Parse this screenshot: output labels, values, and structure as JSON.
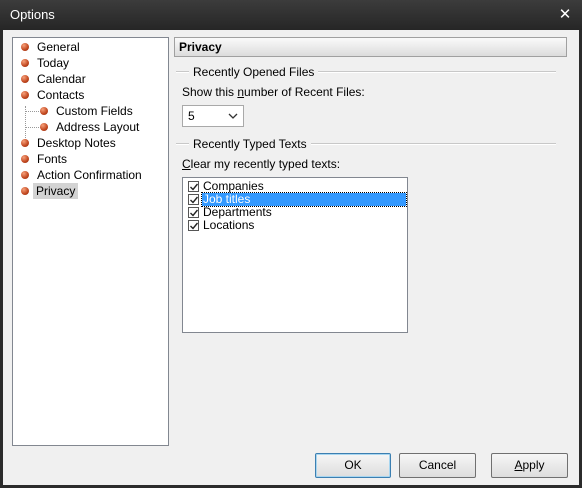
{
  "window": {
    "title": "Options",
    "close_glyph": "✕"
  },
  "tree": {
    "items": [
      {
        "label": "General"
      },
      {
        "label": "Today"
      },
      {
        "label": "Calendar"
      },
      {
        "label": "Contacts"
      },
      {
        "label": "Custom Fields"
      },
      {
        "label": "Address Layout"
      },
      {
        "label": "Desktop Notes"
      },
      {
        "label": "Fonts"
      },
      {
        "label": "Action Confirmation"
      },
      {
        "label": "Privacy"
      }
    ],
    "selected": "Privacy"
  },
  "page": {
    "title": "Privacy",
    "recent_files": {
      "group_label": "Recently Opened Files",
      "prompt_before": "Show this ",
      "prompt_mnemonic": "n",
      "prompt_after": "umber of Recent Files:",
      "count_value": "5"
    },
    "recent_texts": {
      "group_label": "Recently Typed Texts",
      "prompt_mnemonic": "C",
      "prompt_after": "lear my recently typed texts:",
      "items": [
        {
          "label": "Companies",
          "checked": true
        },
        {
          "label": "Job titles",
          "checked": true
        },
        {
          "label": "Departments",
          "checked": true
        },
        {
          "label": "Locations",
          "checked": true
        }
      ]
    }
  },
  "buttons": {
    "ok": "OK",
    "cancel": "Cancel",
    "apply_mnemonic": "A",
    "apply_rest": "pply"
  }
}
